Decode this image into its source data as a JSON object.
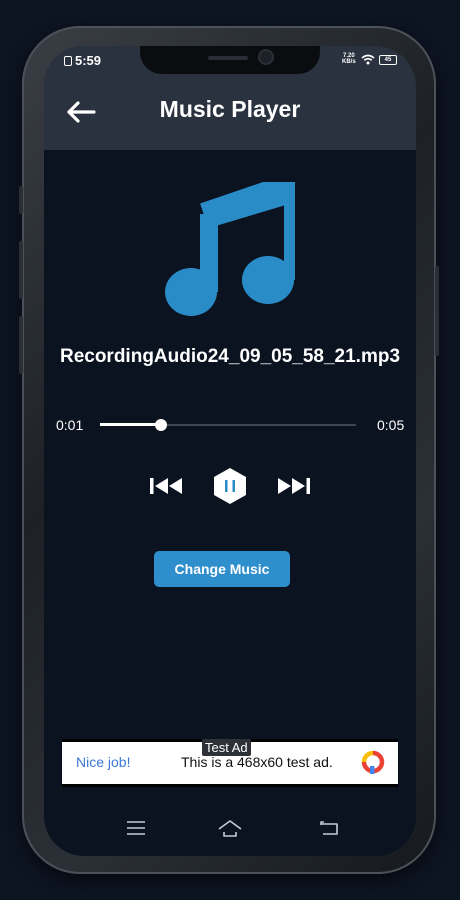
{
  "status": {
    "time": "5:59",
    "net_speed_top": "7.20",
    "net_speed_bottom": "KB/s",
    "battery": "45"
  },
  "app": {
    "title": "Music Player"
  },
  "track": {
    "title": "RecordingAudio24_09_05_58_21.mp3"
  },
  "player": {
    "current_time": "0:01",
    "total_time": "0:05",
    "progress": 0.24,
    "state": "playing"
  },
  "buttons": {
    "change_music": "Change Music"
  },
  "ad": {
    "tag": "Test Ad",
    "cta": "Nice job!",
    "text": "This is a 468x60 test ad."
  },
  "colors": {
    "background": "#0b1220",
    "bar": "#2a3240",
    "accent": "#2f8fcc",
    "icon_blue": "#2a8cc7"
  },
  "icons": [
    "back-arrow-icon",
    "music-note-icon",
    "skip-previous-icon",
    "pause-icon",
    "skip-next-icon",
    "menu-icon",
    "home-icon",
    "back-icon"
  ]
}
